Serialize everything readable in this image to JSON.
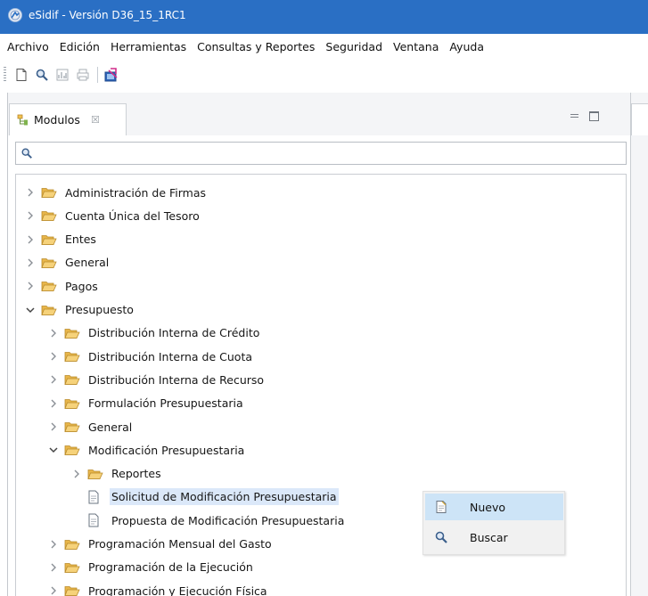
{
  "window": {
    "title": "eSidif - Versión D36_15_1RC1"
  },
  "menubar": {
    "items": [
      "Archivo",
      "Edición",
      "Herramientas",
      "Consultas y Reportes",
      "Seguridad",
      "Ventana",
      "Ayuda"
    ]
  },
  "toolbar": {
    "icons": [
      "new-document-icon",
      "search-icon",
      "chart-icon",
      "print-icon",
      "report-icon"
    ]
  },
  "view": {
    "tab_label": "Modulos",
    "tab_close_symbol": "☒",
    "search_value": ""
  },
  "tree": {
    "items": [
      {
        "label": "Administración de Firmas",
        "level": 0,
        "expanded": false,
        "kind": "folder"
      },
      {
        "label": "Cuenta Única del Tesoro",
        "level": 0,
        "expanded": false,
        "kind": "folder"
      },
      {
        "label": "Entes",
        "level": 0,
        "expanded": false,
        "kind": "folder"
      },
      {
        "label": "General",
        "level": 0,
        "expanded": false,
        "kind": "folder"
      },
      {
        "label": "Pagos",
        "level": 0,
        "expanded": false,
        "kind": "folder"
      },
      {
        "label": "Presupuesto",
        "level": 0,
        "expanded": true,
        "kind": "folder"
      },
      {
        "label": "Distribución Interna de Crédito",
        "level": 1,
        "expanded": false,
        "kind": "folder"
      },
      {
        "label": "Distribución Interna de Cuota",
        "level": 1,
        "expanded": false,
        "kind": "folder"
      },
      {
        "label": "Distribución Interna de Recurso",
        "level": 1,
        "expanded": false,
        "kind": "folder"
      },
      {
        "label": "Formulación Presupuestaria",
        "level": 1,
        "expanded": false,
        "kind": "folder"
      },
      {
        "label": "General",
        "level": 1,
        "expanded": false,
        "kind": "folder"
      },
      {
        "label": "Modificación Presupuestaria",
        "level": 1,
        "expanded": true,
        "kind": "folder"
      },
      {
        "label": "Reportes",
        "level": 2,
        "expanded": false,
        "kind": "folder"
      },
      {
        "label": "Solicitud de Modificación Presupuestaria",
        "level": 2,
        "kind": "document",
        "selected": true
      },
      {
        "label": "Propuesta de Modificación Presupuestaria",
        "level": 2,
        "kind": "document"
      },
      {
        "label": "Programación Mensual del Gasto",
        "level": 1,
        "expanded": false,
        "kind": "folder"
      },
      {
        "label": "Programación de la Ejecución",
        "level": 1,
        "expanded": false,
        "kind": "folder"
      },
      {
        "label": "Programación y Ejecución Física",
        "level": 1,
        "expanded": false,
        "kind": "folder"
      }
    ]
  },
  "context_menu": {
    "items": [
      {
        "label": "Nuevo",
        "icon": "new-document-icon",
        "highlighted": true
      },
      {
        "label": "Buscar",
        "icon": "search-icon",
        "highlighted": false
      }
    ]
  },
  "colors": {
    "titlebar": "#2a6fc4",
    "folder": "#f0c96a",
    "selection": "#dbe8f9",
    "menu_highlight": "#cde4f7"
  }
}
